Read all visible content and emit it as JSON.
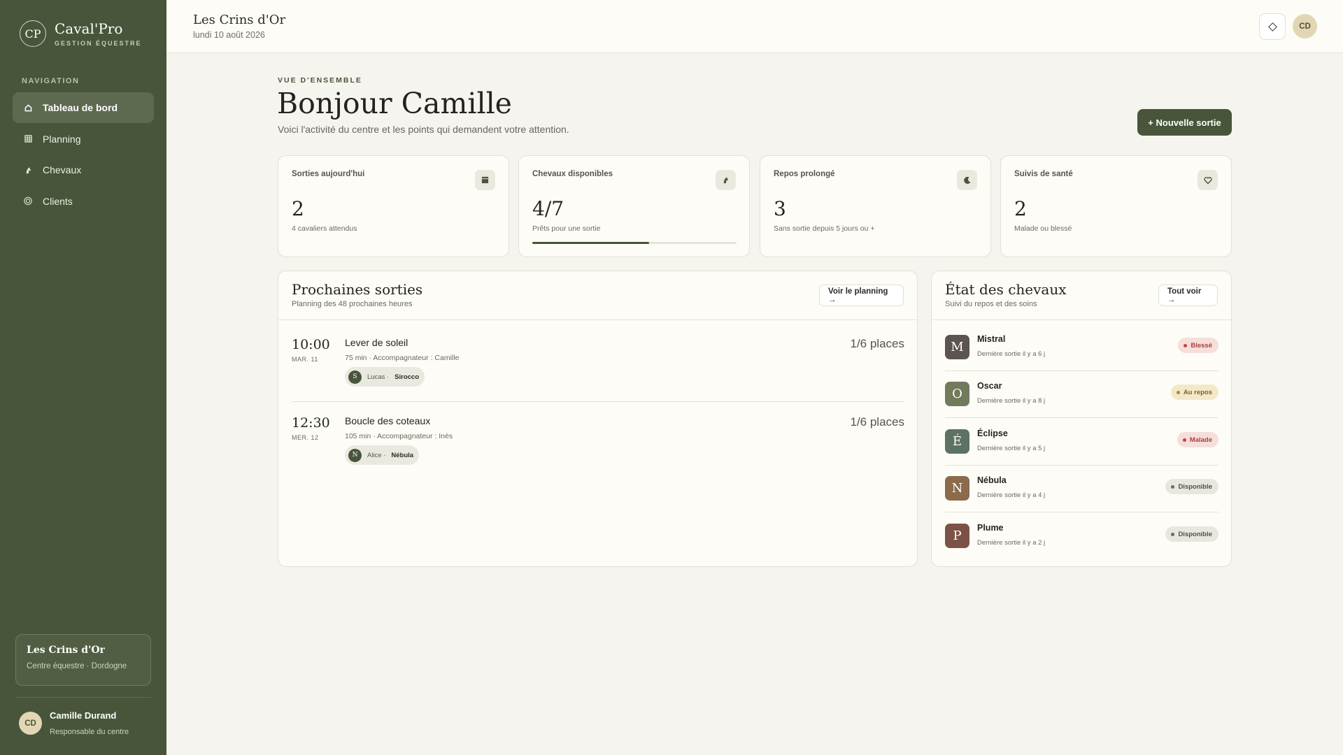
{
  "brand": {
    "logo": "CP",
    "name": "Caval'Pro",
    "subtitle": "GESTION ÉQUESTRE"
  },
  "nav": {
    "heading": "NAVIGATION",
    "items": [
      {
        "label": "Tableau de bord",
        "icon": "home-icon",
        "active": true
      },
      {
        "label": "Planning",
        "icon": "grid-icon",
        "active": false
      },
      {
        "label": "Chevaux",
        "icon": "horse-icon",
        "active": false
      },
      {
        "label": "Clients",
        "icon": "target-icon",
        "active": false
      }
    ]
  },
  "center": {
    "name": "Les Crins d'Or",
    "location": "Centre équestre · Dordogne"
  },
  "user": {
    "initials": "CD",
    "name": "Camille Durand",
    "role": "Responsable du centre"
  },
  "topbar": {
    "title": "Les Crins d'Or",
    "date": "lundi 10 août 2026",
    "avatar": "CD",
    "action_icon": "diamond-icon"
  },
  "hero": {
    "eyebrow": "VUE D'ENSEMBLE",
    "greeting": "Bonjour Camille",
    "subtitle": "Voici l'activité du centre et les points qui demandent votre attention.",
    "new_button": "+ Nouvelle sortie"
  },
  "stats": [
    {
      "label": "Sorties aujourd'hui",
      "value": "2",
      "note": "4 cavaliers attendus",
      "icon": "calendar-icon"
    },
    {
      "label": "Chevaux disponibles",
      "value": "4/7",
      "note": "Prêts pour une sortie",
      "icon": "horse-icon",
      "progress": 0.571
    },
    {
      "label": "Repos prolongé",
      "value": "3",
      "note": "Sans sortie depuis 5 jours ou +",
      "icon": "moon-icon"
    },
    {
      "label": "Suivis de santé",
      "value": "2",
      "note": "Malade ou blessé",
      "icon": "heart-icon"
    }
  ],
  "sessions_panel": {
    "title": "Prochaines sorties",
    "subtitle": "Planning des 48 prochaines heures",
    "button": "Voir le planning →",
    "sessions": [
      {
        "time": "10:00",
        "day": "MAR. 11",
        "name": "Lever de soleil",
        "meta": "75 min · Accompagnateur : Camille",
        "places": "1/6 places",
        "rider_initial": "S",
        "rider": "Lucas ·",
        "horse": "Sirocco"
      },
      {
        "time": "12:30",
        "day": "MER. 12",
        "name": "Boucle des coteaux",
        "meta": "105 min · Accompagnateur : Inès",
        "places": "1/6 places",
        "rider_initial": "N",
        "rider": "Alice ·",
        "horse": "Nébula"
      }
    ]
  },
  "horses_panel": {
    "title": "État des chevaux",
    "subtitle": "Suivi du repos et des soins",
    "button": "Tout voir →",
    "horses": [
      {
        "initial": "M",
        "name": "Mistral",
        "last": "Dernière sortie il y a 6 j",
        "status": "Blessé",
        "avatar_color": "#5b5450",
        "badge_bg": "#f6dedb",
        "badge_fg": "#a8423a",
        "dot": "#c8453c"
      },
      {
        "initial": "O",
        "name": "Oscar",
        "last": "Dernière sortie il y a 8 j",
        "status": "Au repos",
        "avatar_color": "#727a5c",
        "badge_bg": "#f3e8c9",
        "badge_fg": "#7c6424",
        "dot": "#b08a2f"
      },
      {
        "initial": "É",
        "name": "Éclipse",
        "last": "Dernière sortie il y a 5 j",
        "status": "Malade",
        "avatar_color": "#5d7262",
        "badge_bg": "#f6dedb",
        "badge_fg": "#a8423a",
        "dot": "#c8453c"
      },
      {
        "initial": "N",
        "name": "Nébula",
        "last": "Dernière sortie il y a 4 j",
        "status": "Disponible",
        "avatar_color": "#8c6a4c",
        "badge_bg": "#e7e7df",
        "badge_fg": "#50504a",
        "dot": "#6b6b62"
      },
      {
        "initial": "P",
        "name": "Plume",
        "last": "Dernière sortie il y a 2 j",
        "status": "Disponible",
        "avatar_color": "#7c5246",
        "badge_bg": "#e7e7df",
        "badge_fg": "#50504a",
        "dot": "#6b6b62"
      }
    ]
  }
}
